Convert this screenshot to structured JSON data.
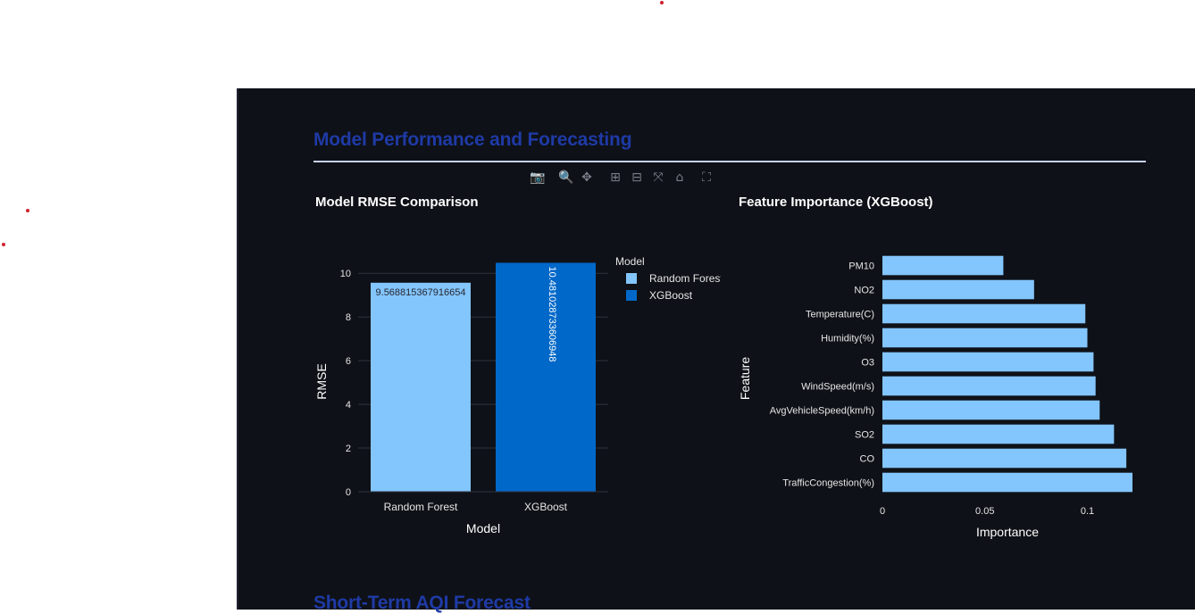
{
  "page": {
    "section_title": "Model Performance and Forecasting",
    "next_section_title": "Short-Term AQI Forecast"
  },
  "toolbar": [
    {
      "icon": "camera-icon",
      "glyph": "📷"
    },
    {
      "icon": "zoom-icon",
      "glyph": "🔍"
    },
    {
      "icon": "pan-icon",
      "glyph": "✥"
    },
    {
      "icon": "zoom-in-icon",
      "glyph": "⊞"
    },
    {
      "icon": "zoom-out-icon",
      "glyph": "⊟"
    },
    {
      "icon": "autoscale-icon",
      "glyph": "⤧"
    },
    {
      "icon": "home-icon",
      "glyph": "⌂"
    },
    {
      "icon": "fullscreen-icon",
      "glyph": "⛶"
    }
  ],
  "colors": {
    "background": "#0e1117",
    "random_forest": "#83c5fd",
    "xgboost": "#0068c9",
    "heading": "#1f3aa6"
  },
  "chart_data": [
    {
      "type": "bar",
      "title": "Model RMSE Comparison",
      "xlabel": "Model",
      "ylabel": "RMSE",
      "categories": [
        "Random Forest",
        "XGBoost"
      ],
      "values": [
        9.568815367916654,
        10.481028733606948
      ],
      "value_labels": [
        "9.568815367916654",
        "10.481028733606948"
      ],
      "ylim": [
        0,
        10.5
      ],
      "yticks": [
        0,
        2,
        4,
        6,
        8,
        10
      ],
      "legend": {
        "title": "Model",
        "position": "right",
        "entries": [
          {
            "name": "Random Forest",
            "color": "#83c5fd"
          },
          {
            "name": "XGBoost",
            "color": "#0068c9"
          }
        ]
      },
      "grid": true
    },
    {
      "type": "bar",
      "orientation": "horizontal",
      "title": "Feature Importance (XGBoost)",
      "xlabel": "Importance",
      "ylabel": "Feature",
      "categories": [
        "PM10",
        "NO2",
        "Temperature(C)",
        "Humidity(%)",
        "O3",
        "WindSpeed(m/s)",
        "AvgVehicleSpeed(km/h)",
        "SO2",
        "CO",
        "TrafficCongestion(%)"
      ],
      "values": [
        0.059,
        0.074,
        0.099,
        0.1,
        0.103,
        0.104,
        0.106,
        0.113,
        0.119,
        0.122
      ],
      "xlim": [
        0,
        0.122
      ],
      "xticks": [
        0,
        0.05,
        0.1
      ],
      "xtick_labels": [
        "0",
        "0.05",
        "0.1"
      ],
      "color": "#83c5fd",
      "grid": false
    }
  ]
}
